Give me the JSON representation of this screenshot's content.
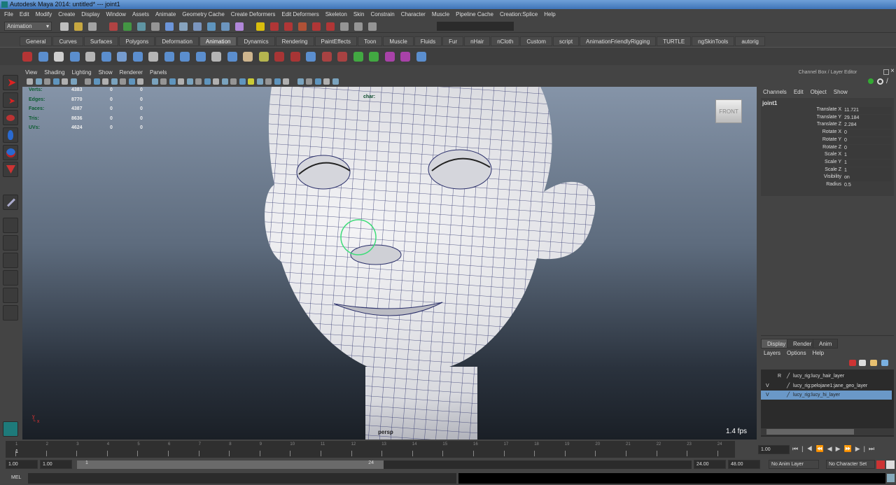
{
  "window": {
    "title": "Autodesk Maya 2014: untitled*   ---   joint1"
  },
  "menu": [
    "File",
    "Edit",
    "Modify",
    "Create",
    "Display",
    "Window",
    "Assets",
    "Animate",
    "Geometry Cache",
    "Create Deformers",
    "Edit Deformers",
    "Skeleton",
    "Skin",
    "Constrain",
    "Character",
    "Muscle",
    "Pipeline Cache",
    "Creation:Splice",
    "Help"
  ],
  "status_line": {
    "menu_set": "Animation"
  },
  "shelf_tabs": [
    "General",
    "Curves",
    "Surfaces",
    "Polygons",
    "Deformation",
    "Animation",
    "Dynamics",
    "Rendering",
    "PaintEffects",
    "Toon",
    "Muscle",
    "Fluids",
    "Fur",
    "nHair",
    "nCloth",
    "Custom",
    "script",
    "AnimationFriendlyRigging",
    "TURTLE",
    "ngSkinTools",
    "autorig"
  ],
  "active_shelf_tab": "Animation",
  "viewport": {
    "menu": [
      "View",
      "Shading",
      "Lighting",
      "Show",
      "Renderer",
      "Panels"
    ],
    "hud": [
      {
        "label": "Verts:",
        "v": [
          "4383",
          "0",
          "0"
        ]
      },
      {
        "label": "Edges:",
        "v": [
          "8770",
          "0",
          "0"
        ]
      },
      {
        "label": "Faces:",
        "v": [
          "4387",
          "0",
          "0"
        ]
      },
      {
        "label": "Tris:",
        "v": [
          "8636",
          "0",
          "0"
        ]
      },
      {
        "label": "UVs:",
        "v": [
          "4624",
          "0",
          "0"
        ]
      }
    ],
    "char_label": "char:",
    "camera": "persp",
    "fps": "1.4 fps",
    "viewcube": "FRONT"
  },
  "channel_box": {
    "title": "Channel Box / Layer Editor",
    "menu": [
      "Channels",
      "Edit",
      "Object",
      "Show"
    ],
    "object": "joint1",
    "channels": [
      {
        "name": "Translate X",
        "value": "11.721"
      },
      {
        "name": "Translate Y",
        "value": "29.184"
      },
      {
        "name": "Translate Z",
        "value": "2.284"
      },
      {
        "name": "Rotate X",
        "value": "0"
      },
      {
        "name": "Rotate Y",
        "value": "0"
      },
      {
        "name": "Rotate Z",
        "value": "0"
      },
      {
        "name": "Scale X",
        "value": "1"
      },
      {
        "name": "Scale Y",
        "value": "1"
      },
      {
        "name": "Scale Z",
        "value": "1"
      },
      {
        "name": "Visibility",
        "value": "on"
      },
      {
        "name": "Radius",
        "value": "0.5"
      }
    ]
  },
  "layer_editor": {
    "tabs": [
      "Display",
      "Render",
      "Anim"
    ],
    "menu": [
      "Layers",
      "Options",
      "Help"
    ],
    "layers": [
      {
        "v": "",
        "r": "R",
        "name": "lucy_rig:lucy_hair_layer"
      },
      {
        "v": "V",
        "r": "",
        "name": "lucy_rig:pelojane1:jane_geo_layer"
      },
      {
        "v": "V",
        "r": "",
        "name": "lucy_rig:lucy_hi_layer"
      }
    ]
  },
  "timeline": {
    "ticks": [
      "1",
      "2",
      "3",
      "4",
      "5",
      "6",
      "7",
      "8",
      "9",
      "10",
      "11",
      "12",
      "13",
      "14",
      "15",
      "16",
      "17",
      "18",
      "19",
      "20",
      "21",
      "22",
      "23",
      "24"
    ],
    "current_frame": "1",
    "current_time": "1.00"
  },
  "range": {
    "start": "1.00",
    "playback_start": "1.00",
    "slider_start": "1",
    "slider_end": "24",
    "playback_end": "24.00",
    "end": "48.00",
    "anim_layer": "No Anim Layer",
    "character_set": "No Character Set"
  },
  "command_line": {
    "label": "MEL"
  }
}
